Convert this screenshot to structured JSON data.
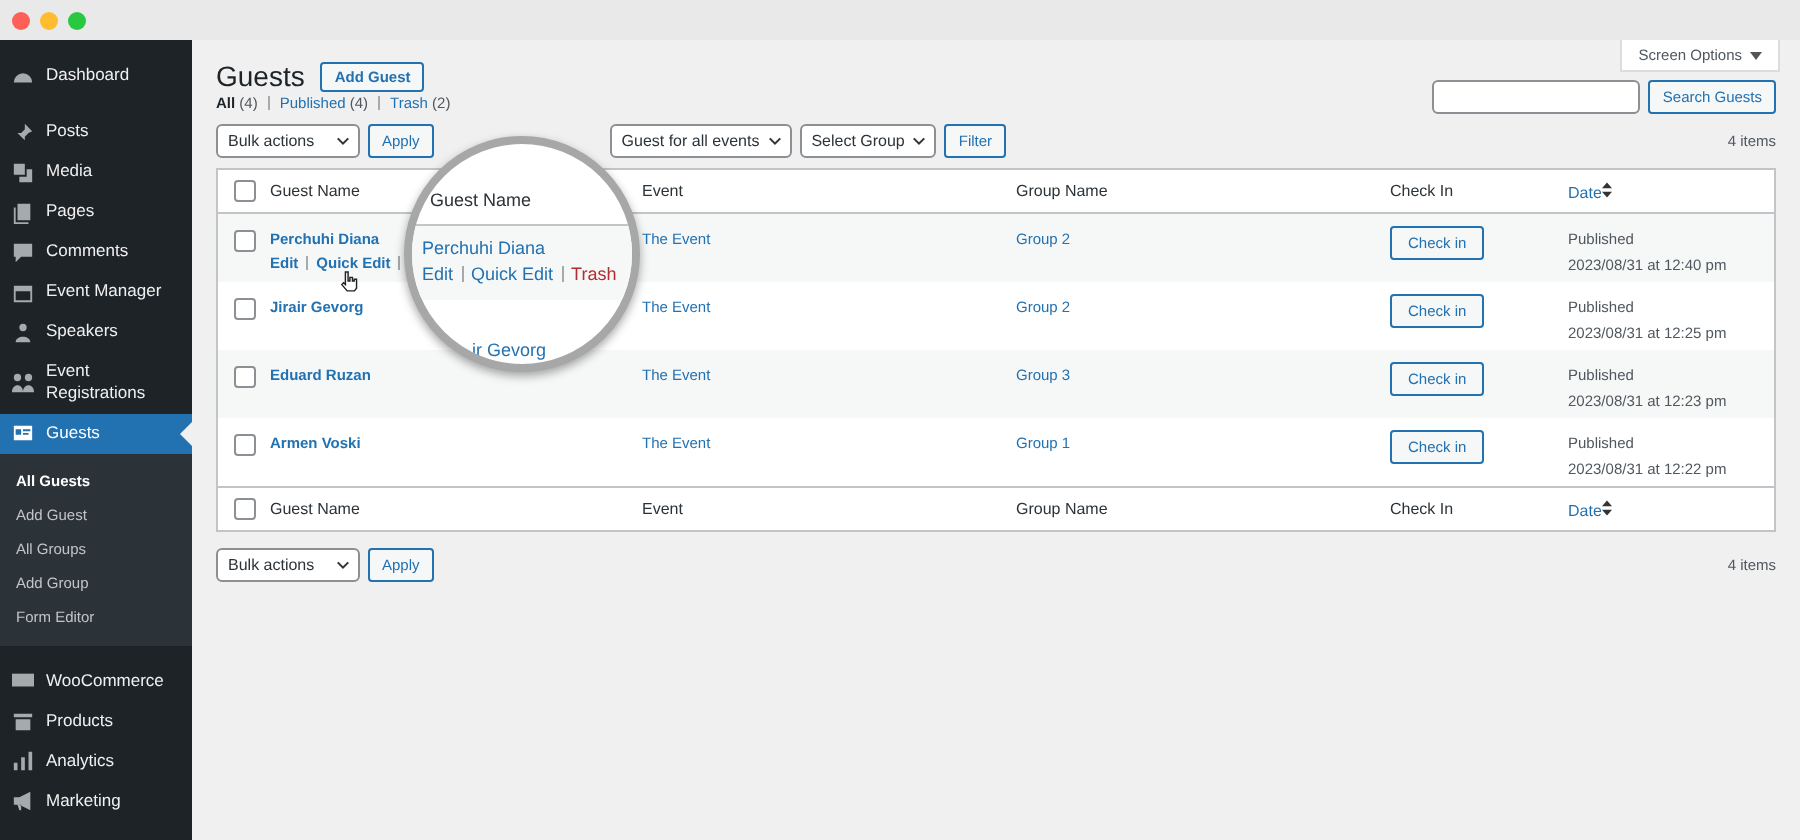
{
  "sidebar": {
    "items": [
      {
        "label": "Dashboard",
        "selected": false
      },
      {
        "label": "Posts",
        "selected": false
      },
      {
        "label": "Media",
        "selected": false
      },
      {
        "label": "Pages",
        "selected": false
      },
      {
        "label": "Comments",
        "selected": false
      },
      {
        "label": "Event Manager",
        "selected": false
      },
      {
        "label": "Speakers",
        "selected": false
      },
      {
        "label": "Event Registrations",
        "selected": false
      },
      {
        "label": "Guests",
        "selected": true,
        "children": [
          {
            "label": "All Guests",
            "selected": true
          },
          {
            "label": "Add Guest",
            "selected": false
          },
          {
            "label": "All Groups",
            "selected": false
          },
          {
            "label": "Add Group",
            "selected": false
          },
          {
            "label": "Form Editor",
            "selected": false
          }
        ]
      },
      {
        "label": "WooCommerce",
        "selected": false
      },
      {
        "label": "Products",
        "selected": false
      },
      {
        "label": "Analytics",
        "selected": false
      },
      {
        "label": "Marketing",
        "selected": false
      }
    ]
  },
  "screen_options": "Screen Options",
  "page_title": "Guests",
  "add_button": "Add Guest",
  "views": [
    {
      "label": "All",
      "count": "(4)",
      "selected": true
    },
    {
      "label": "Published",
      "count": "(4)",
      "selected": false
    },
    {
      "label": "Trash",
      "count": "(2)",
      "selected": false
    }
  ],
  "search": {
    "button": "Search Guests"
  },
  "toolbar": {
    "bulk_actions": "Bulk actions",
    "apply": "Apply",
    "event_filter": "Guest for all events",
    "group_filter": "Select Group",
    "filter": "Filter",
    "count": "4 items"
  },
  "table": {
    "columns": [
      "Guest Name",
      "Event",
      "Group Name",
      "Check In",
      "Date"
    ],
    "header_checked": false,
    "rows": [
      {
        "name": "Perchuhi Diana",
        "checked": false,
        "actions": [
          {
            "label": "Edit",
            "kind": "link"
          },
          {
            "label": "Quick Edit",
            "kind": "link"
          }
        ],
        "event": "The Event",
        "group": "Group 2",
        "check_in": "Check in",
        "status": "Published",
        "date": "2023/08/31 at 12:40 pm"
      },
      {
        "name": "Jirair Gevorg",
        "checked": false,
        "event": "The Event",
        "group": "Group 2",
        "check_in": "Check in",
        "status": "Published",
        "date": "2023/08/31 at 12:25 pm"
      },
      {
        "name": "Eduard Ruzan",
        "checked": false,
        "event": "The Event",
        "group": "Group 3",
        "check_in": "Check in",
        "status": "Published",
        "date": "2023/08/31 at 12:23 pm"
      },
      {
        "name": "Armen Voski",
        "checked": false,
        "event": "The Event",
        "group": "Group 1",
        "check_in": "Check in",
        "status": "Published",
        "date": "2023/08/31 at 12:22 pm"
      }
    ],
    "footer_checked": false,
    "footer_columns": [
      "Guest Name",
      "Event",
      "Group Name",
      "Check In",
      "Date"
    ]
  },
  "bottom_toolbar": {
    "bulk_actions": "Bulk actions",
    "apply": "Apply",
    "count": "4 items"
  },
  "magnifier": {
    "header": "Guest Name",
    "name": "Perchuhi Diana",
    "actions": [
      {
        "label": "Edit",
        "kind": "link"
      },
      {
        "label": "Quick Edit",
        "kind": "link"
      },
      {
        "label": "Trash",
        "kind": "delete"
      }
    ],
    "next_name": "ir Gevorg"
  }
}
